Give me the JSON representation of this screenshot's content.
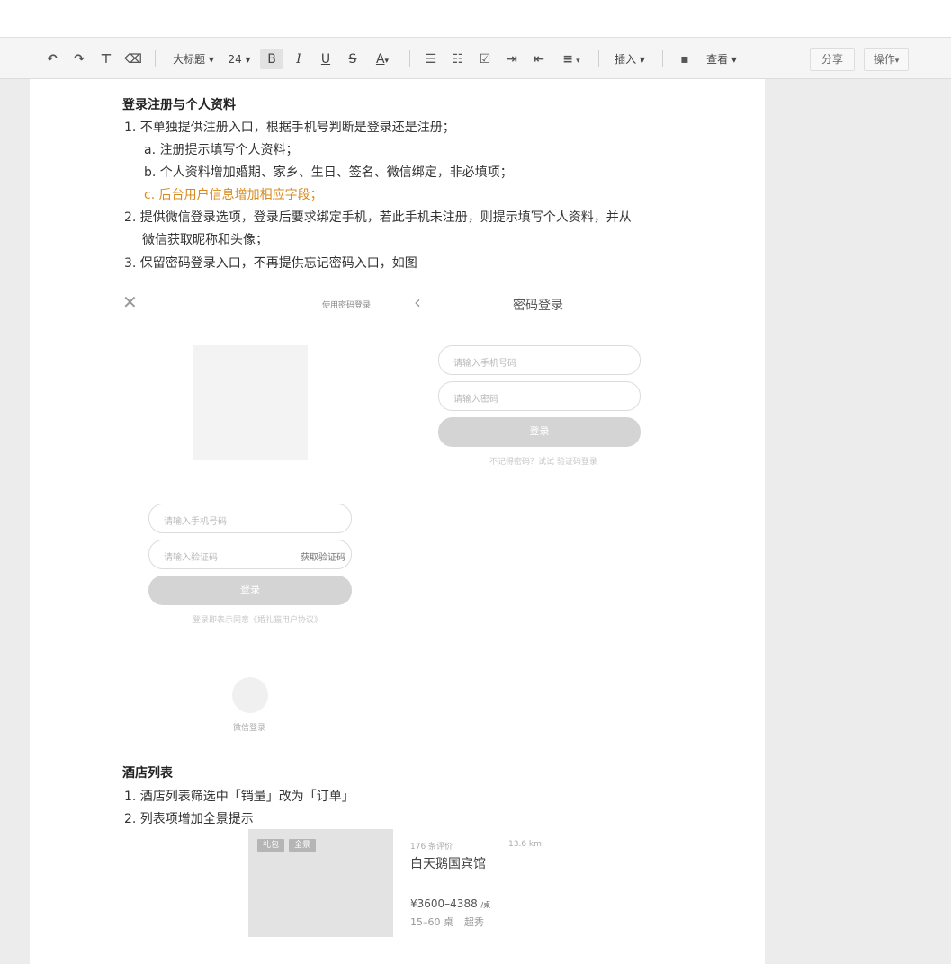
{
  "toolbar": {
    "undo_icon": "undo-icon",
    "redo_icon": "redo-icon",
    "format_painter_icon": "format-painter-icon",
    "eraser_icon": "eraser-icon",
    "style_label": "大标题",
    "font_size_label": "24",
    "bold_label": "B",
    "italic_label": "I",
    "underline_label": "U",
    "strike_label": "S",
    "font_color_label": "A",
    "insert_label": "插入",
    "view_label": "查看",
    "share_label": "分享",
    "actions_label": "操作"
  },
  "section1": {
    "heading": "登录注册与个人资料",
    "item1": "1.  不单独提供注册入口，根据手机号判断是登录还是注册；",
    "item1a": "a.  注册提示填写个人资料；",
    "item1b": "b.  个人资料增加婚期、家乡、生日、签名、微信绑定，非必填项；",
    "item1c": "c.  后台用户信息增加相应字段；",
    "item2_line1": "2.  提供微信登录选项，登录后要求绑定手机，若此手机未注册，则提示填写个人资料，并从",
    "item2_line2": "微信获取昵称和头像；",
    "item3": "3.  保留密码登录入口，不再提供忘记密码入口，如图"
  },
  "mock_sms": {
    "password_login_link": "使用密码登录",
    "phone_placeholder": "请输入手机号码",
    "code_placeholder": "请输入验证码",
    "get_code_button": "获取验证码",
    "login_button": "登录",
    "agreement": "登录即表示同意《婚礼猫用户协议》",
    "wechat_login": "微信登录"
  },
  "mock_password": {
    "title": "密码登录",
    "phone_placeholder": "请输入手机号码",
    "password_placeholder": "请输入密码",
    "login_button": "登录",
    "footer": "不记得密码？试试 验证码登录"
  },
  "section2": {
    "heading": "酒店列表",
    "item1": "1.  酒店列表筛选中「销量」改为「订单」",
    "item2": "2.  列表项增加全景提示"
  },
  "hotel_card": {
    "tag1": "礼包",
    "tag2": "全景",
    "reviews": "176 条评价",
    "distance": "13.6 km",
    "name": "白天鹅国宾馆",
    "price": "¥3600–4388",
    "price_unit": "/桌",
    "tables": "15–60 桌",
    "rating": "超秀"
  }
}
